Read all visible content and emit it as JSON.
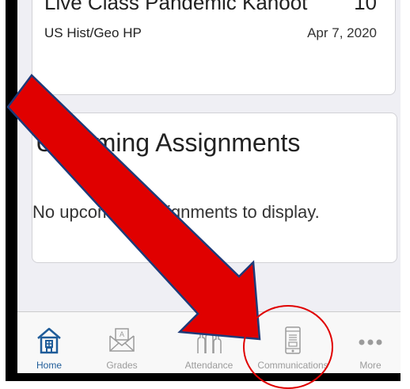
{
  "recent_assignment": {
    "title": "Live Class Pandemic Kahoot",
    "count": "10",
    "class_name": "US Hist/Geo HP",
    "date": "Apr 7, 2020"
  },
  "upcoming": {
    "title": "Upcoming Assignments",
    "empty_message": "No upcoming assignments to display."
  },
  "tabbar": {
    "tabs": [
      {
        "label": "Home",
        "icon": "home-icon",
        "active": true
      },
      {
        "label": "Grades",
        "icon": "grades-envelope-icon",
        "active": false
      },
      {
        "label": "Attendance",
        "icon": "attendance-hands-icon",
        "active": false
      },
      {
        "label": "Communications",
        "icon": "communications-phone-icon",
        "active": false
      },
      {
        "label": "More",
        "icon": "more-dots-icon",
        "active": false
      }
    ]
  },
  "colors": {
    "accent": "#1f5c99",
    "inactive": "#9b9b9b",
    "arrow": "#e00000",
    "background": "#efeff4"
  }
}
